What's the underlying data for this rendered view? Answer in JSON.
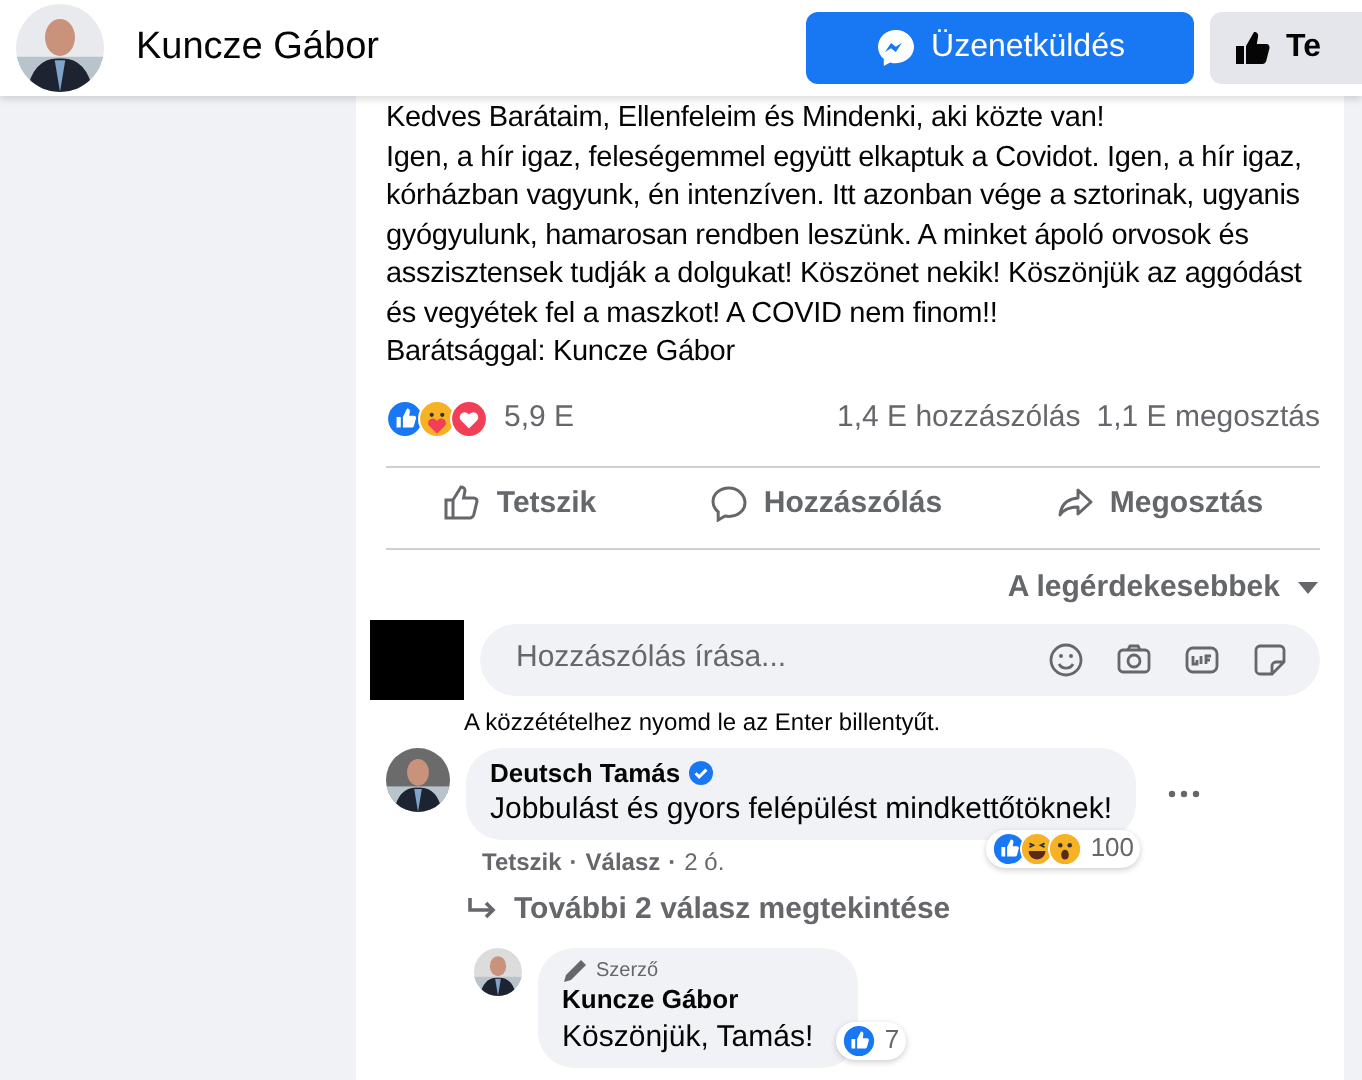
{
  "header": {
    "name": "Kuncze Gábor",
    "buttons": [
      {
        "label": "Üzenetküldés",
        "kind": "message"
      },
      {
        "label": "Te",
        "kind": "like"
      }
    ]
  },
  "post": {
    "paragraphs": [
      "Kedves Barátaim, Ellenfeleim és Mindenki, aki közte van!",
      "Igen, a hír igaz, feleségemmel együtt elkaptuk a Covidot. Igen, a hír igaz, kórházban vagyunk, én intenzíven. Itt azonban vége a sztorinak, ugyanis gyógyulunk, hamarosan rendben leszünk. A minket ápoló orvosok és asszisztensek tudják a dolgukat! Köszönet nekik! Köszönjük az aggódást és vegyétek fel a maszkot! A COVID nem finom!!",
      "Barátsággal: Kuncze Gábor"
    ],
    "reactions": [
      {
        "kind": "like"
      },
      {
        "kind": "care"
      },
      {
        "kind": "love"
      }
    ],
    "reaction_count": "5,9 E",
    "comments_count": "1,4 E hozzászólás",
    "shares_count": "1,1 E megosztás",
    "actions": [
      {
        "label": "Tetszik",
        "kind": "like"
      },
      {
        "label": "Hozzászólás",
        "kind": "comment"
      },
      {
        "label": "Megosztás",
        "kind": "share"
      }
    ],
    "sort": "A legérdekesebbek"
  },
  "composer": {
    "placeholder": "Hozzászólás írása...",
    "hint": "A közzétételhez nyomd le az Enter billentyűt."
  },
  "comments": [
    {
      "author": "Deutsch Tamás",
      "verified": true,
      "text": "Jobbulást és gyors felépülést mindkettőtöknek!",
      "reactions": [
        {
          "kind": "like"
        },
        {
          "kind": "haha"
        },
        {
          "kind": "wow"
        }
      ],
      "reaction_count": "100",
      "meta": [
        {
          "text": "Tetszik",
          "kind": "link"
        },
        {
          "text": "·",
          "kind": "dot"
        },
        {
          "text": "Válasz",
          "kind": "link"
        },
        {
          "text": "·",
          "kind": "dot"
        },
        {
          "text": "2 ó.",
          "kind": "time"
        }
      ],
      "more_replies": "További 2 válasz megtekintése",
      "replies": [
        {
          "badge": "Szerző",
          "author": "Kuncze Gábor",
          "verified": false,
          "text": "Köszönjük, Tamás!",
          "reactions": [
            {
              "kind": "like"
            }
          ],
          "reaction_count": "7"
        }
      ]
    }
  ]
}
